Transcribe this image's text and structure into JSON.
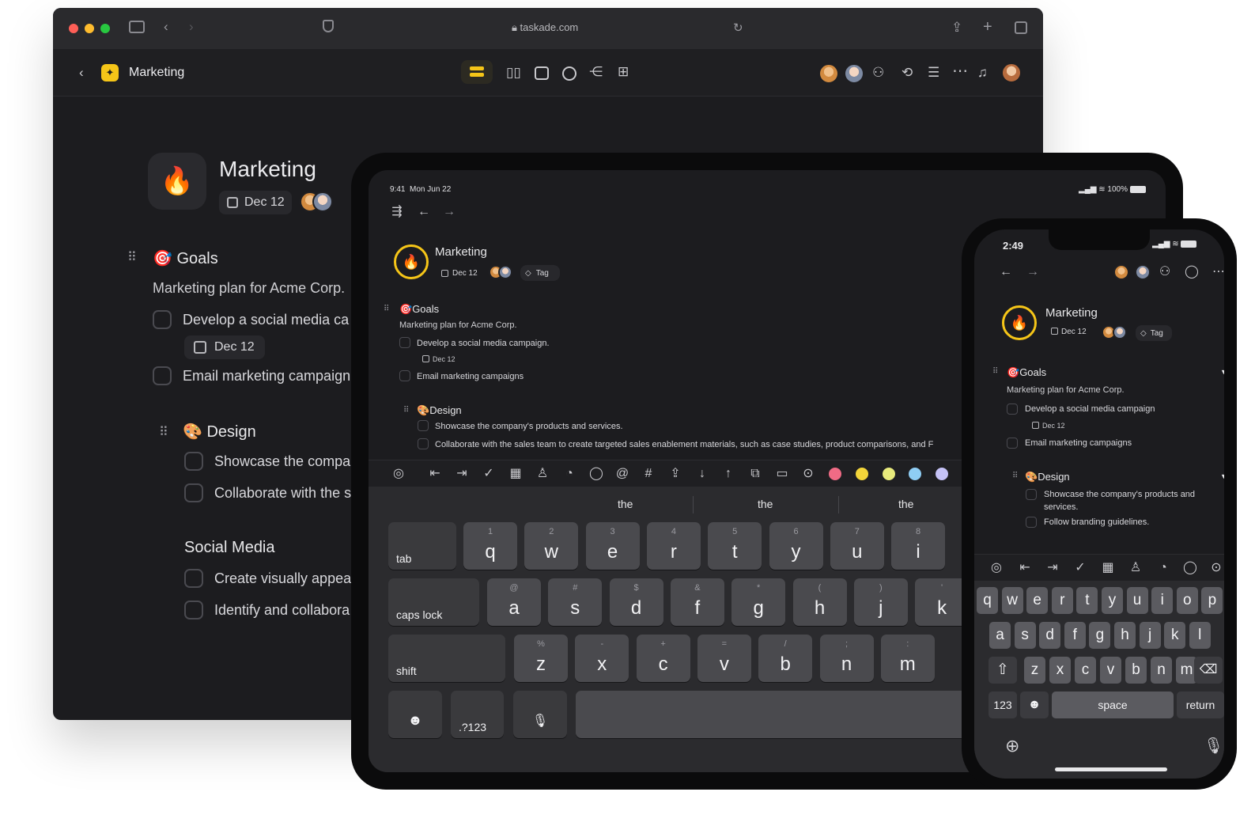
{
  "desktop": {
    "url": "taskade.com",
    "breadcrumb_title": "Marketing",
    "project_title": "Marketing",
    "date_chip": "Dec 12",
    "goals": {
      "emoji": "🎯",
      "title": "Goals",
      "subtitle": "Marketing plan for Acme Corp.",
      "tasks": [
        "Develop a social media ca",
        "Email marketing campaign"
      ],
      "task_date": "Dec 12"
    },
    "design": {
      "emoji": "🎨",
      "title": "Design",
      "tasks": [
        "Showcase the compa",
        "Collaborate with the s"
      ]
    },
    "social": {
      "title": "Social Media",
      "tasks": [
        "Create visually appea",
        "Identify and collabora"
      ]
    }
  },
  "tablet": {
    "status_time": "9:41",
    "status_date": "Mon Jun 22",
    "battery": "100%",
    "project_title": "Marketing",
    "date_chip": "Dec 12",
    "tag_chip": "Tag",
    "goals": {
      "title": "Goals",
      "subtitle": "Marketing plan for Acme Corp.",
      "tasks": [
        "Develop a social media campaign.",
        "Email marketing campaigns"
      ],
      "task_date": "Dec 12"
    },
    "design": {
      "title": "Design",
      "tasks": [
        "Showcase the company's products and services.",
        "Collaborate with the sales team to create targeted sales enablement materials, such as case studies, product comparisons, and F"
      ]
    },
    "suggestions": [
      "the",
      "the",
      "the"
    ],
    "keyboard": {
      "row1": [
        {
          "h": "1",
          "k": "q"
        },
        {
          "h": "2",
          "k": "w"
        },
        {
          "h": "3",
          "k": "e"
        },
        {
          "h": "4",
          "k": "r"
        },
        {
          "h": "5",
          "k": "t"
        },
        {
          "h": "6",
          "k": "y"
        },
        {
          "h": "7",
          "k": "u"
        },
        {
          "h": "8",
          "k": "i"
        }
      ],
      "row2": [
        {
          "h": "@",
          "k": "a"
        },
        {
          "h": "#",
          "k": "s"
        },
        {
          "h": "$",
          "k": "d"
        },
        {
          "h": "&",
          "k": "f"
        },
        {
          "h": "*",
          "k": "g"
        },
        {
          "h": "(",
          "k": "h"
        },
        {
          "h": ")",
          "k": "j"
        },
        {
          "h": "'",
          "k": "k"
        }
      ],
      "row3": [
        {
          "h": "%",
          "k": "z"
        },
        {
          "h": "-",
          "k": "x"
        },
        {
          "h": "+",
          "k": "c"
        },
        {
          "h": "=",
          "k": "v"
        },
        {
          "h": "/",
          "k": "b"
        },
        {
          "h": ";",
          "k": "n"
        },
        {
          "h": ":",
          "k": "m"
        }
      ],
      "tab": "tab",
      "caps": "caps lock",
      "shift": "shift",
      "numbers": ".?123"
    },
    "colors": [
      "#f06b85",
      "#f3d53a",
      "#e8ea7c",
      "#8fcdf4",
      "#c5c2f6"
    ]
  },
  "phone": {
    "status_time": "2:49",
    "project_title": "Marketing",
    "date_chip": "Dec 12",
    "tag_chip": "Tag",
    "goals": {
      "title": "Goals",
      "subtitle": "Marketing plan for Acme Corp.",
      "tasks": [
        "Develop a social media campaign",
        "Email marketing campaigns"
      ],
      "task_date": "Dec 12"
    },
    "design": {
      "title": "Design",
      "task1_line1": "Showcase the company's products and",
      "task1_line2": "services.",
      "task2": "Follow branding guidelines."
    },
    "keyboard": {
      "row1": [
        "q",
        "w",
        "e",
        "r",
        "t",
        "y",
        "u",
        "i",
        "o",
        "p"
      ],
      "row2": [
        "a",
        "s",
        "d",
        "f",
        "g",
        "h",
        "j",
        "k",
        "l"
      ],
      "row3": [
        "z",
        "x",
        "c",
        "v",
        "b",
        "n",
        "m"
      ],
      "numbers": "123",
      "space": "space",
      "return": "return"
    }
  }
}
